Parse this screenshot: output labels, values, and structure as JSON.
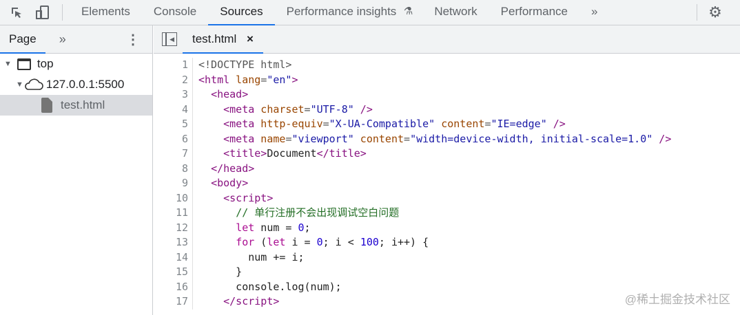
{
  "toolbar": {
    "tabs": [
      "Elements",
      "Console",
      "Sources",
      "Performance insights",
      "Network",
      "Performance"
    ],
    "active": "Sources",
    "more": "»"
  },
  "sidebar": {
    "tab": "Page",
    "more": "»",
    "tree": [
      {
        "label": "top",
        "icon": "frame-icon"
      },
      {
        "label": "127.0.0.1:5500",
        "icon": "cloud-icon"
      },
      {
        "label": "test.html",
        "icon": "file-icon"
      }
    ]
  },
  "editor": {
    "file_tab": "test.html",
    "close": "×",
    "lines": [
      [
        [
          "t-punct",
          "<!DOCTYPE html>"
        ]
      ],
      [
        [
          "t-tag",
          "<html"
        ],
        [
          "t-attr",
          " lang"
        ],
        [
          "t-punct",
          "="
        ],
        [
          "t-val",
          "\"en\""
        ],
        [
          "t-tag",
          ">"
        ]
      ],
      [
        [
          "t-text",
          "  "
        ],
        [
          "t-tag",
          "<head>"
        ]
      ],
      [
        [
          "t-text",
          "    "
        ],
        [
          "t-tag",
          "<meta"
        ],
        [
          "t-attr",
          " charset"
        ],
        [
          "t-punct",
          "="
        ],
        [
          "t-val",
          "\"UTF-8\""
        ],
        [
          "t-tag",
          " />"
        ]
      ],
      [
        [
          "t-text",
          "    "
        ],
        [
          "t-tag",
          "<meta"
        ],
        [
          "t-attr",
          " http-equiv"
        ],
        [
          "t-punct",
          "="
        ],
        [
          "t-val",
          "\"X-UA-Compatible\""
        ],
        [
          "t-attr",
          " content"
        ],
        [
          "t-punct",
          "="
        ],
        [
          "t-val",
          "\"IE=edge\""
        ],
        [
          "t-tag",
          " />"
        ]
      ],
      [
        [
          "t-text",
          "    "
        ],
        [
          "t-tag",
          "<meta"
        ],
        [
          "t-attr",
          " name"
        ],
        [
          "t-punct",
          "="
        ],
        [
          "t-val",
          "\"viewport\""
        ],
        [
          "t-attr",
          " content"
        ],
        [
          "t-punct",
          "="
        ],
        [
          "t-val",
          "\"width=device-width, initial-scale=1.0\""
        ],
        [
          "t-tag",
          " />"
        ]
      ],
      [
        [
          "t-text",
          "    "
        ],
        [
          "t-tag",
          "<title>"
        ],
        [
          "t-text",
          "Document"
        ],
        [
          "t-tag",
          "</title>"
        ]
      ],
      [
        [
          "t-text",
          "  "
        ],
        [
          "t-tag",
          "</head>"
        ]
      ],
      [
        [
          "t-text",
          "  "
        ],
        [
          "t-tag",
          "<body>"
        ]
      ],
      [
        [
          "t-text",
          "    "
        ],
        [
          "t-tag",
          "<script>"
        ]
      ],
      [
        [
          "t-text",
          "      "
        ],
        [
          "t-cmt",
          "// 单行注册不会出现调试空白问题"
        ]
      ],
      [
        [
          "t-text",
          "      "
        ],
        [
          "t-kw",
          "let"
        ],
        [
          "t-text",
          " num = "
        ],
        [
          "t-num",
          "0"
        ],
        [
          "t-text",
          ";"
        ]
      ],
      [
        [
          "t-text",
          "      "
        ],
        [
          "t-kw",
          "for"
        ],
        [
          "t-text",
          " ("
        ],
        [
          "t-kw",
          "let"
        ],
        [
          "t-text",
          " i = "
        ],
        [
          "t-num",
          "0"
        ],
        [
          "t-text",
          "; i < "
        ],
        [
          "t-num",
          "100"
        ],
        [
          "t-text",
          "; i++) {"
        ]
      ],
      [
        [
          "t-text",
          "        num += i;"
        ]
      ],
      [
        [
          "t-text",
          "      }"
        ]
      ],
      [
        [
          "t-text",
          "      console.log(num);"
        ]
      ],
      [
        [
          "t-text",
          "    "
        ],
        [
          "t-tag",
          "</script>"
        ]
      ]
    ]
  },
  "watermark": "@稀土掘金技术社区"
}
